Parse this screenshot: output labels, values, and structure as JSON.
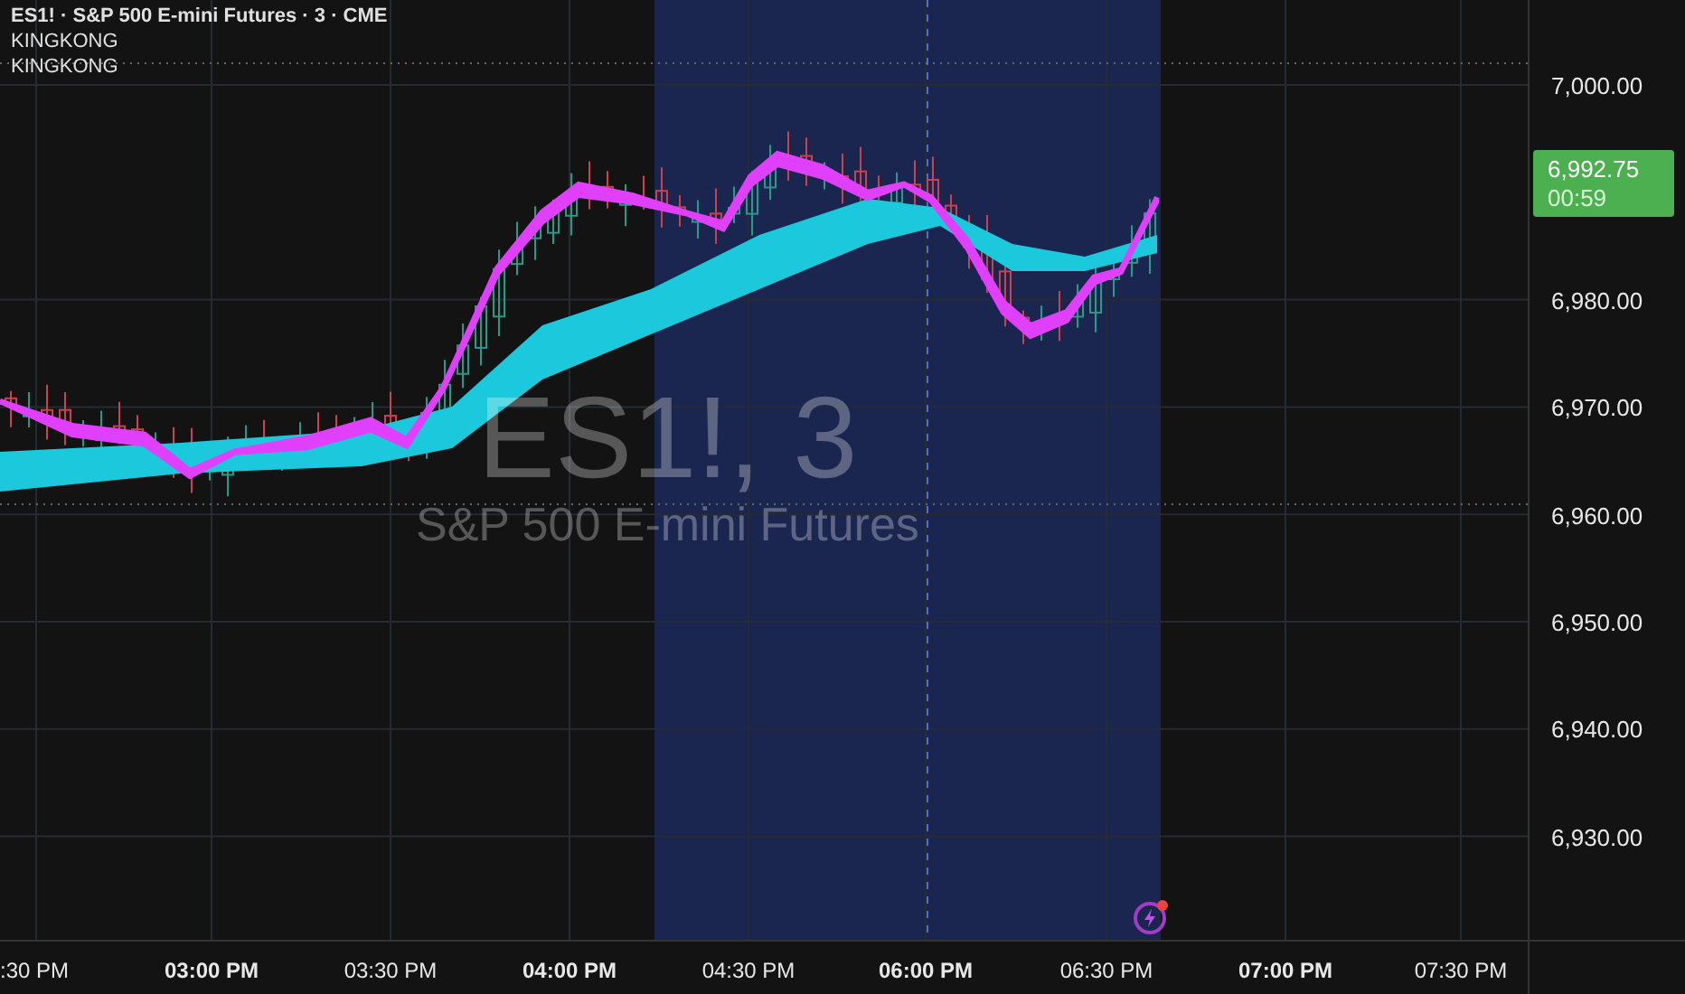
{
  "legend": {
    "symbol": "ES1! · S&P 500 E-mini Futures · 3 · CME",
    "indicators": [
      "KINGKONG",
      "KINGKONG"
    ]
  },
  "watermark": {
    "ticker": "ES1!, 3",
    "name": "S&P 500 E-mini Futures"
  },
  "price_axis": {
    "labels": [
      "7,000.00",
      "6,980.00",
      "6,970.00",
      "6,960.00",
      "6,950.00",
      "6,940.00",
      "6,930.00"
    ],
    "last_price": "6,992.75",
    "countdown": "00:59"
  },
  "time_axis": {
    "labels": [
      {
        "text": ":30 PM",
        "major": false
      },
      {
        "text": "03:00 PM",
        "major": true
      },
      {
        "text": "03:30 PM",
        "major": false
      },
      {
        "text": "04:00 PM",
        "major": true
      },
      {
        "text": "04:30 PM",
        "major": false
      },
      {
        "text": "06:00 PM",
        "major": true
      },
      {
        "text": "06:30 PM",
        "major": false
      },
      {
        "text": "07:00 PM",
        "major": true
      },
      {
        "text": "07:30 PM",
        "major": false
      }
    ]
  }
}
